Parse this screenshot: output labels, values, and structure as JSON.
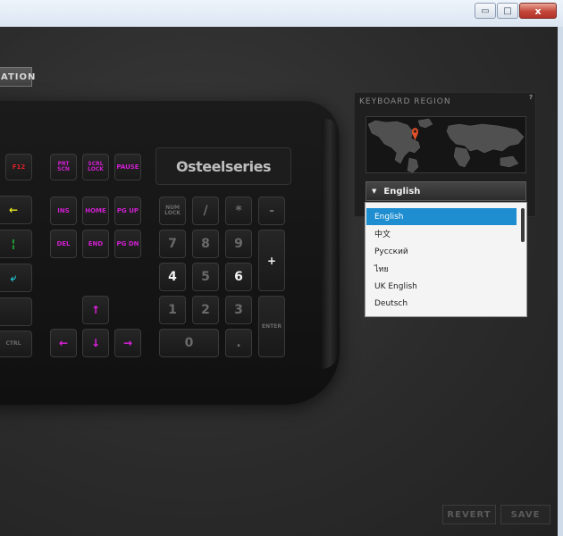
{
  "window": {
    "minimize_glyph": "▭",
    "maximize_glyph": "□",
    "close_glyph": "x"
  },
  "toolbar": {
    "config_button_partial": "ATION"
  },
  "keyboard": {
    "brand": "ʘsteelseries",
    "keys": {
      "f12": "F12",
      "prtscn": "PRT SCN",
      "scrlock": "SCRL LOCK",
      "pause": "PAUSE",
      "ins": "INS",
      "home": "HOME",
      "pgup": "PG UP",
      "del": "DEL",
      "end": "END",
      "pgdn": "PG DN",
      "numlock": "NUM LOCK",
      "slash": "/",
      "star": "*",
      "minus": "-",
      "n7": "7",
      "n8": "8",
      "n9": "9",
      "plus": "+",
      "n4": "4",
      "n5": "5",
      "n6": "6",
      "n1": "1",
      "n2": "2",
      "n3": "3",
      "enter": "ENTER",
      "n0": "0",
      "dot": ".",
      "ctrl": "CTRL",
      "up": "↑",
      "left": "←",
      "down": "↓",
      "right": "→",
      "yellow_arrow": "←",
      "green_mark": "¦",
      "cyan_mark": "⤶"
    }
  },
  "region": {
    "title": "KEYBOARD REGION",
    "help": "?",
    "selected": "English",
    "caret": "▼",
    "options": [
      "English",
      "中文",
      "Русский",
      "ไทย",
      "UK English",
      "Deutsch"
    ]
  },
  "footer": {
    "revert": "REVERT",
    "save": "SAVE"
  },
  "colors": {
    "accent": "#1e8ed0",
    "key_magenta": "#d01fd0",
    "pin_orange": "#e2512a"
  }
}
